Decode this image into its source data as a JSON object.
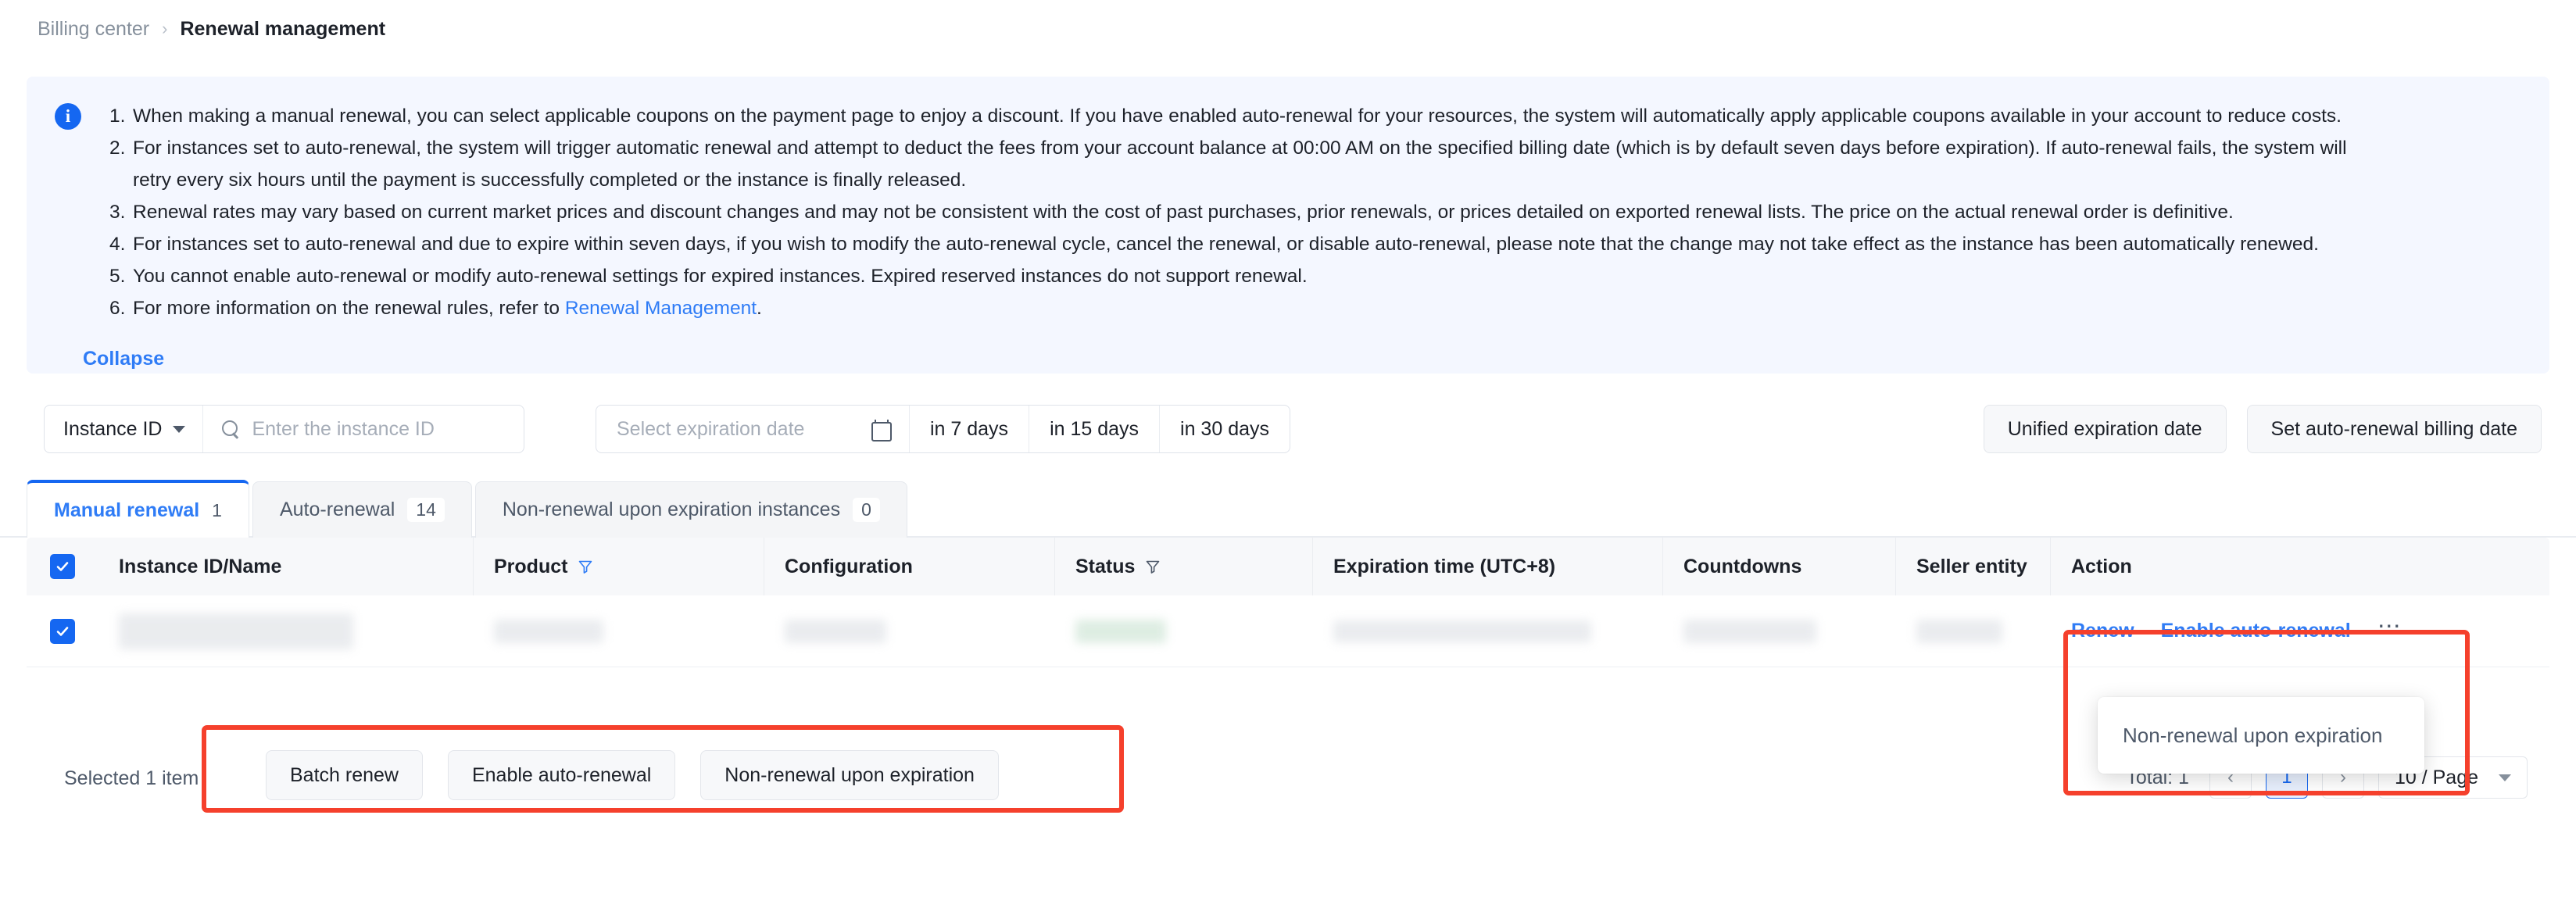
{
  "breadcrumb": {
    "parent": "Billing center",
    "separator": "›",
    "current": "Renewal management"
  },
  "notice": {
    "icon": "info-circle-icon",
    "items": [
      {
        "num": "1.",
        "text": "When making a manual renewal, you can select applicable coupons on the payment page to enjoy a discount. If you have enabled auto-renewal for your resources, the system will automatically apply applicable coupons available in your account to reduce costs."
      },
      {
        "num": "2.",
        "text": "For instances set to auto-renewal, the system will trigger automatic renewal and attempt to deduct the fees from your account balance at 00:00 AM on the specified billing date (which is by default seven days before expiration). If auto-renewal fails, the system will",
        "text2": "retry every six hours until the payment is successfully completed or the instance is finally released."
      },
      {
        "num": "3.",
        "text": "Renewal rates may vary based on current market prices and discount changes and may not be consistent with the cost of past purchases, prior renewals, or prices detailed on exported renewal lists. The price on the actual renewal order is definitive."
      },
      {
        "num": "4.",
        "text": "For instances set to auto-renewal and due to expire within seven days, if you wish to modify the auto-renewal cycle, cancel the renewal, or disable auto-renewal, please note that the change may not take effect as the instance has been automatically renewed."
      },
      {
        "num": "5.",
        "text": "You cannot enable auto-renewal or modify auto-renewal settings for expired instances. Expired reserved instances do not support renewal."
      },
      {
        "num": "6.",
        "text_before": "For more information on the renewal rules, refer to ",
        "link": "Renewal Management",
        "text_after": "."
      }
    ],
    "collapse_label": "Collapse"
  },
  "toolbar": {
    "filter_select_label": "Instance ID",
    "search_placeholder": "Enter the instance ID",
    "search_value": "",
    "date_placeholder": "Select expiration date",
    "quick_days": [
      "in 7 days",
      "in 15 days",
      "in 30 days"
    ],
    "unified_expiration_button": "Unified expiration date",
    "set_billing_date_button": "Set auto-renewal billing date"
  },
  "tabs": [
    {
      "label": "Manual renewal",
      "count": "1",
      "active": true
    },
    {
      "label": "Auto-renewal",
      "count": "14",
      "active": false
    },
    {
      "label": "Non-renewal upon expiration instances",
      "count": "0",
      "active": false
    }
  ],
  "table": {
    "columns": [
      "Instance ID/Name",
      "Product",
      "Configuration",
      "Status",
      "Expiration time (UTC+8)",
      "Countdowns",
      "Seller entity",
      "Action"
    ],
    "header_all_checked": true,
    "rows": [
      {
        "checked": true,
        "instance_id": "",
        "product": "",
        "configuration": "",
        "status": "",
        "expiration_time": "",
        "countdowns": "",
        "seller_entity": "",
        "actions": [
          "Renew",
          "Enable auto-renewal"
        ],
        "more_icon": "ellipsis-icon"
      }
    ]
  },
  "action_dropdown": {
    "visible": true,
    "items": [
      "Non-renewal upon expiration"
    ]
  },
  "footer": {
    "selected_text": "Selected 1 item",
    "batch_buttons": [
      "Batch renew",
      "Enable auto-renewal",
      "Non-renewal upon expiration"
    ],
    "pagination": {
      "total": "Total: 1",
      "prev": "‹",
      "next": "›",
      "current_page": "1",
      "page_size": "10 / Page"
    }
  },
  "highlights": {
    "accent_red": "#f5402c",
    "accent_blue": "#1567f1",
    "link_blue": "#2f7cf6"
  }
}
